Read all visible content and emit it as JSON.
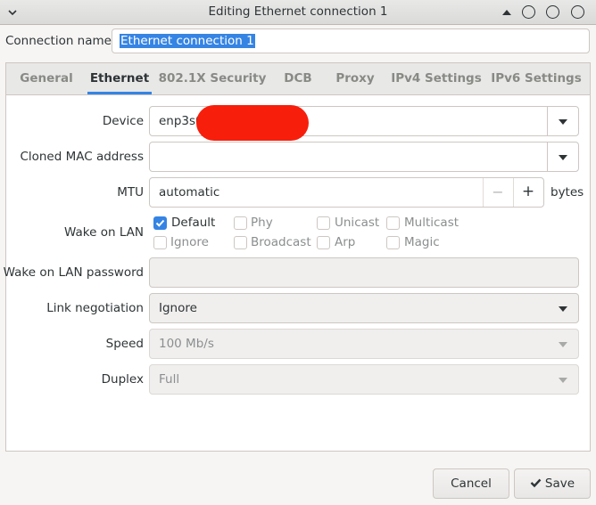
{
  "window": {
    "title": "Editing Ethernet connection 1"
  },
  "connection": {
    "label": "Connection name",
    "value": "Ethernet connection 1"
  },
  "tabs": [
    {
      "label": "General"
    },
    {
      "label": "Ethernet"
    },
    {
      "label": "802.1X Security"
    },
    {
      "label": "DCB"
    },
    {
      "label": "Proxy"
    },
    {
      "label": "IPv4 Settings"
    },
    {
      "label": "IPv6 Settings"
    }
  ],
  "active_tab": "Ethernet",
  "ethernet": {
    "device": {
      "label": "Device",
      "value": "enp3s0"
    },
    "cloned_mac": {
      "label": "Cloned MAC address",
      "value": ""
    },
    "mtu": {
      "label": "MTU",
      "value": "automatic",
      "unit": "bytes",
      "minus": "−",
      "plus": "+"
    },
    "wake_on_lan": {
      "label": "Wake on LAN",
      "options": [
        {
          "label": "Default",
          "checked": true
        },
        {
          "label": "Phy",
          "checked": false
        },
        {
          "label": "Unicast",
          "checked": false
        },
        {
          "label": "Multicast",
          "checked": false
        },
        {
          "label": "Ignore",
          "checked": false
        },
        {
          "label": "Broadcast",
          "checked": false
        },
        {
          "label": "Arp",
          "checked": false
        },
        {
          "label": "Magic",
          "checked": false
        }
      ]
    },
    "wol_password": {
      "label": "Wake on LAN password",
      "value": ""
    },
    "link_negotiation": {
      "label": "Link negotiation",
      "value": "Ignore"
    },
    "speed": {
      "label": "Speed",
      "value": "100 Mb/s"
    },
    "duplex": {
      "label": "Duplex",
      "value": "Full"
    }
  },
  "buttons": {
    "cancel": "Cancel",
    "save": "Save"
  },
  "colors": {
    "accent": "#3584e4",
    "redaction": "#f71e0c"
  }
}
